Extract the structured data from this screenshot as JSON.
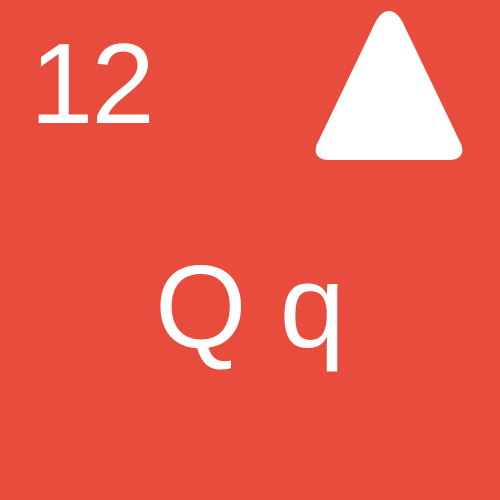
{
  "card": {
    "background_color": "#e74c3c",
    "foreground_color": "#ffffff",
    "number": "12",
    "symbol_icon": "triangle-up-icon",
    "letters": "Q q"
  }
}
